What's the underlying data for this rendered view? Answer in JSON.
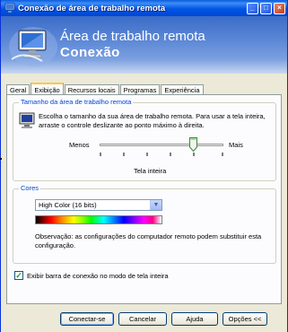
{
  "window": {
    "title": "Conexão de área de trabalho remota",
    "controls": {
      "minimize": "_",
      "maximize": "□",
      "close": "×"
    }
  },
  "banner": {
    "line1": "Área de trabalho remota",
    "line2": "Conexão",
    "icon": "remote-desktop-monitor-icon"
  },
  "tabs": [
    {
      "label": "Geral",
      "active": false
    },
    {
      "label": "Exibição",
      "active": true
    },
    {
      "label": "Recursos locais",
      "active": false
    },
    {
      "label": "Programas",
      "active": false
    },
    {
      "label": "Experiência",
      "active": false
    }
  ],
  "display_size": {
    "legend": "Tamanho da área de trabalho remota",
    "description": "Escolha o tamanho da sua área de trabalho remota. Para usar a tela inteira, arraste o controle deslizante ao ponto máximo à direita.",
    "label_less": "Menos",
    "label_more": "Mais",
    "value_text": "Tela inteira",
    "slider_level": 1.0
  },
  "colors": {
    "legend": "Cores",
    "selected": "High Color (16 bits)",
    "note": "Observação: as configurações do computador remoto podem substituir esta configuração."
  },
  "connection_bar": {
    "label": "Exibir barra de conexão no modo de tela inteira",
    "checked": true
  },
  "buttons": {
    "connect": "Conectar-se",
    "cancel": "Cancelar",
    "help": "Ajuda",
    "options": "Opções <<"
  },
  "theme": {
    "titlebar": "#0055e5",
    "window_bg": "#ece9d8",
    "legend_text": "#0046d5"
  }
}
